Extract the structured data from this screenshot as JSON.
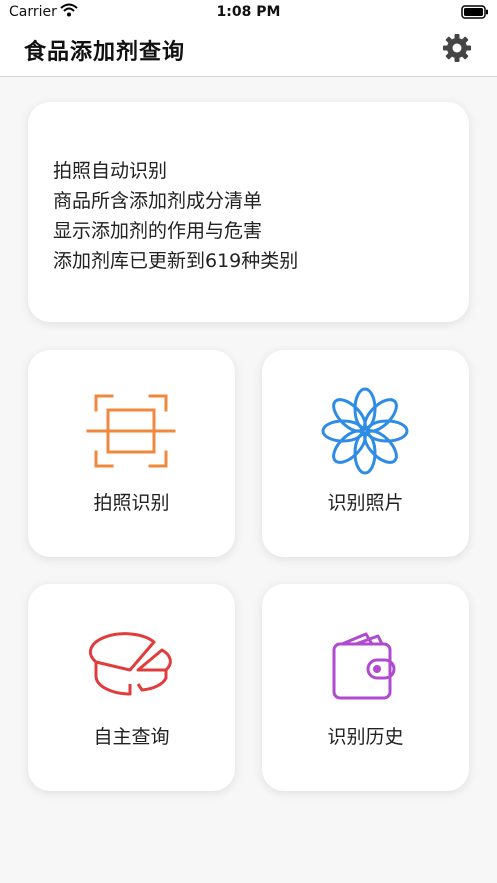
{
  "status_bar": {
    "carrier": "Carrier",
    "time": "1:08 PM"
  },
  "nav": {
    "title": "食品添加剂查询",
    "settings_icon": "gear-icon"
  },
  "info": {
    "lines": [
      "拍照自动识别",
      "商品所含添加剂成分清单",
      "显示添加剂的作用与危害",
      "添加剂库已更新到619种类别"
    ]
  },
  "tiles": [
    {
      "label": "拍照识别",
      "icon": "scan-icon",
      "color": "#f0883e"
    },
    {
      "label": "识别照片",
      "icon": "flower-icon",
      "color": "#2e8ce6"
    },
    {
      "label": "自主查询",
      "icon": "pie-chart-icon",
      "color": "#e03c3c"
    },
    {
      "label": "识别历史",
      "icon": "wallet-icon",
      "color": "#b04ad0"
    }
  ]
}
